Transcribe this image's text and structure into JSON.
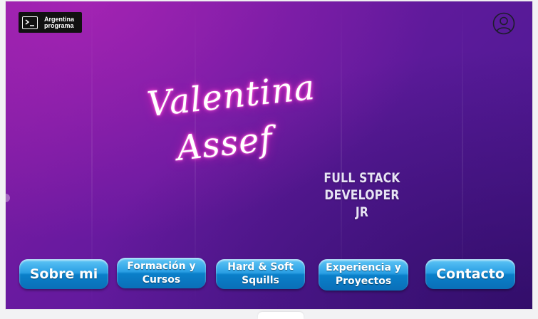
{
  "logo": {
    "line1": "Argentina",
    "line2": "programa"
  },
  "hero": {
    "first_name": "Valentina",
    "last_name": "Assef",
    "role_line1": "FULL STACK DEVELOPER",
    "role_line2": "JR"
  },
  "nav": {
    "about": "Sobre mi",
    "education_line1": "Formación y",
    "education_line2": "Cursos",
    "skills_line1": "Hard & Soft",
    "skills_line2": "Squills",
    "experience_line1": "Experiencia y",
    "experience_line2": "Proyectos",
    "contact": "Contacto"
  },
  "colors": {
    "background_start": "#8a1fa6",
    "background_end": "#4a1790",
    "button_blue": "#1a8fd8",
    "neon_pink": "#ff4fd8"
  },
  "icons": {
    "user": "user-circle-icon",
    "terminal": "terminal-prompt-icon"
  }
}
